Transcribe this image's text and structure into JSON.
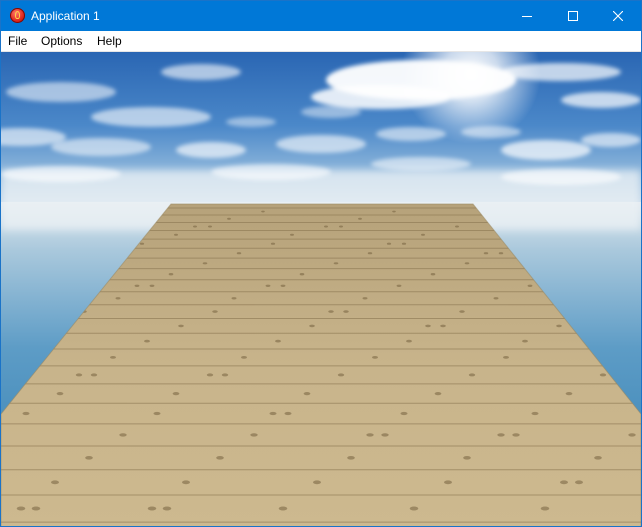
{
  "window": {
    "title": "Application 1",
    "icon": "app-flame-icon",
    "controls": [
      "minimize-icon",
      "maximize-icon",
      "close-icon"
    ]
  },
  "menu": {
    "file": "File",
    "options": "Options",
    "help": "Help"
  },
  "scene": {
    "description_icons": [
      "sky",
      "clouds",
      "sun",
      "sea",
      "wooden-plank-floor"
    ],
    "colors": {
      "titlebar": "#0078d7",
      "sky_top": "#2e6db8",
      "sky_horizon": "#e8eef2",
      "sea": "#3e88b8",
      "wood": "#c9b58a"
    }
  }
}
